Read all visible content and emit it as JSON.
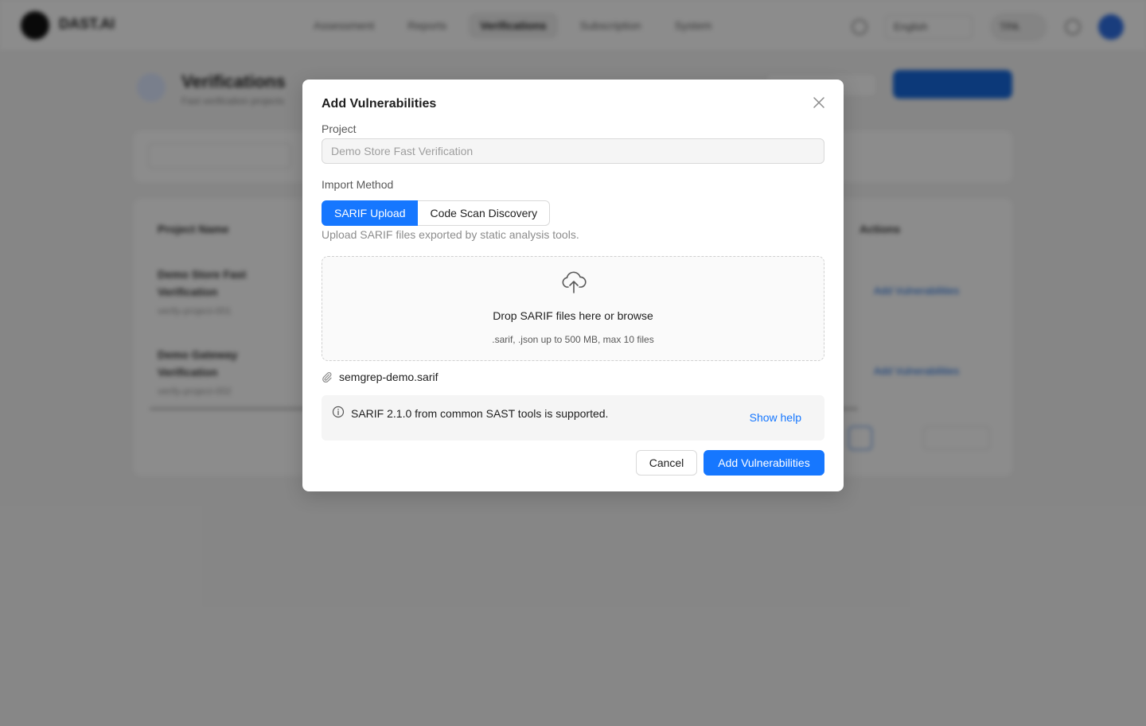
{
  "app": {
    "logo_text": "DAST.AI"
  },
  "nav": {
    "items": [
      {
        "label": "Assessment"
      },
      {
        "label": "Reports"
      },
      {
        "label": "Verifications"
      },
      {
        "label": "Subscription"
      },
      {
        "label": "System"
      }
    ],
    "active": "Verifications",
    "language": "English",
    "user": "TPA"
  },
  "page": {
    "title": "Verifications",
    "subtitle": "Fast verification projects",
    "table": {
      "headers": [
        "Project Name",
        "Actions"
      ],
      "rows": [
        {
          "name": "Demo Store Fast Verification",
          "sub": "verify-project-001",
          "action": "Add Vulnerabilities"
        },
        {
          "name": "Demo Gateway Verification",
          "sub": "verify-project-002",
          "action": "Add Vulnerabilities"
        }
      ],
      "page": "1",
      "page_size": "10 / page"
    }
  },
  "modal": {
    "title": "Add Vulnerabilities",
    "project_label": "Project",
    "project_value": "Demo Store Fast Verification",
    "import_method_label": "Import Method",
    "methods": [
      "SARIF Upload",
      "Code Scan Discovery"
    ],
    "selected_method": "SARIF Upload",
    "hint": "Upload SARIF files exported by static analysis tools.",
    "dropzone": {
      "title": "Drop SARIF files here or browse",
      "subtitle": ".sarif, .json up to 500 MB, max 10 files"
    },
    "attached_file": "semgrep-demo.sarif",
    "info": {
      "text": "SARIF 2.1.0 from common SAST tools is supported.",
      "link": "Show help"
    },
    "cancel_label": "Cancel",
    "submit_label": "Add Vulnerabilities"
  },
  "colors": {
    "primary": "#1677ff",
    "overlay": "rgba(0,0,0,0.45)"
  }
}
